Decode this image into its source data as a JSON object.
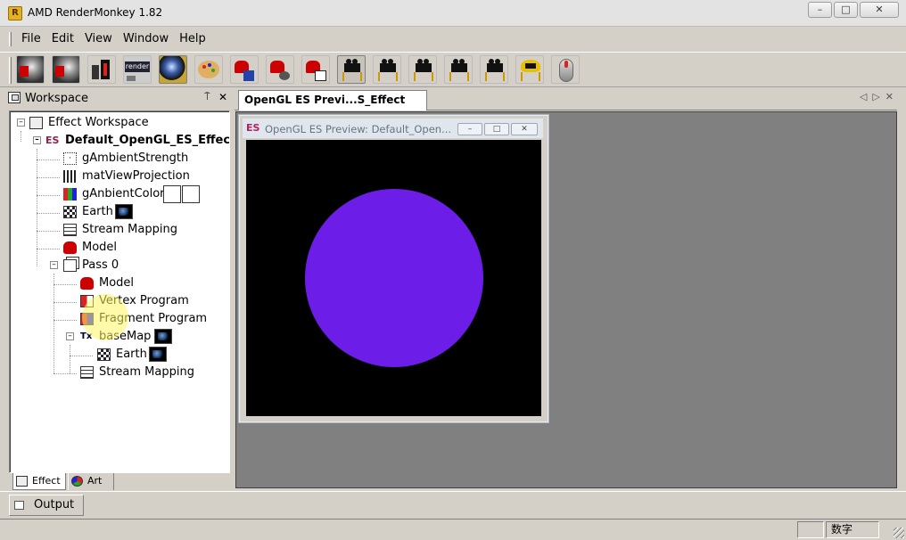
{
  "window": {
    "title": "AMD RenderMonkey 1.82",
    "app_icon": "rendermonkey-icon"
  },
  "menu": [
    {
      "label": "File"
    },
    {
      "label": "Edit"
    },
    {
      "label": "View"
    },
    {
      "label": "Window"
    },
    {
      "label": "Help"
    }
  ],
  "toolbar": {
    "buttons": [
      {
        "icon": "new-workspace-icon"
      },
      {
        "icon": "open-workspace-icon"
      },
      {
        "icon": "add-effect-icon"
      },
      {
        "icon": "render-view-icon"
      },
      {
        "icon": "preview-sphere-icon"
      },
      {
        "icon": "art-palette-icon"
      },
      {
        "icon": "compile-icon"
      },
      {
        "icon": "compile-all-icon"
      },
      {
        "icon": "commit-icon"
      },
      {
        "icon": "camera-icon"
      },
      {
        "icon": "camera-reset-icon"
      },
      {
        "icon": "camera-front-icon"
      },
      {
        "icon": "camera-side-icon"
      },
      {
        "icon": "camera-top-icon"
      },
      {
        "icon": "camera-overload-icon"
      },
      {
        "icon": "mouse-icon"
      }
    ]
  },
  "workspace": {
    "title": "Workspace",
    "pin": "⍑",
    "close": "✕",
    "tree": [
      {
        "label": "Effect Workspace",
        "icon": "workspace-icon"
      },
      {
        "label": "Default_OpenGL_ES_Effect",
        "icon": "es-effect-icon"
      },
      {
        "label": "gAmbientStrength",
        "icon": "scalar-variable-icon"
      },
      {
        "label": "matViewProjection",
        "icon": "matrix-variable-icon"
      },
      {
        "label": "gAnbientColor",
        "icon": "color-variable-icon"
      },
      {
        "label": "Earth",
        "icon": "texture-icon"
      },
      {
        "label": "Stream Mapping",
        "icon": "stream-mapping-icon"
      },
      {
        "label": "Model",
        "icon": "model-icon"
      },
      {
        "label": "Pass 0",
        "icon": "pass-icon"
      },
      {
        "label": "Model",
        "icon": "model-ref-icon"
      },
      {
        "label": "Vertex Program",
        "icon": "vertex-program-icon"
      },
      {
        "label": "Fragment Program",
        "icon": "fragment-program-icon"
      },
      {
        "label": "baseMap",
        "icon": "texture-object-icon"
      },
      {
        "label": "Earth",
        "icon": "texture-ref-icon"
      },
      {
        "label": "Stream Mapping",
        "icon": "stream-mapping-icon"
      }
    ],
    "tabs": [
      {
        "label": "Effect"
      },
      {
        "label": "Art"
      }
    ]
  },
  "document": {
    "tab_label": "OpenGL ES Previ...S_Effect effect",
    "nav_left": "◁",
    "nav_right": "▷",
    "nav_close": "✕",
    "preview": {
      "icon_text": "ES",
      "title": "OpenGL ES Preview: Default_Open...",
      "min": "–",
      "max": "□",
      "close": "✕",
      "circle_color": "#6c1ee8"
    }
  },
  "output": {
    "label": "Output"
  },
  "status": {
    "num_indicator": "数字"
  }
}
